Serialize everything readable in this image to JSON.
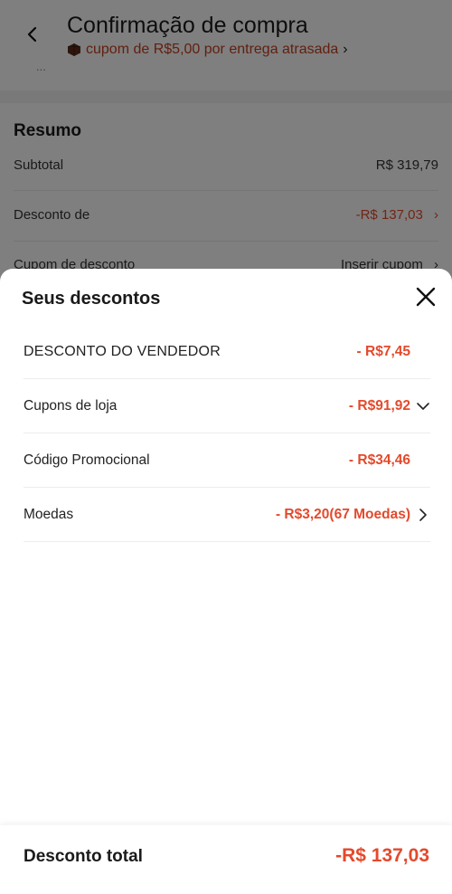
{
  "header": {
    "title": "Confirmação de compra",
    "subtitle": "cupom de R$5,00 por entrega atrasada",
    "subtitle_chevron": "›",
    "cut_text": "..."
  },
  "summary": {
    "title": "Resumo",
    "rows": [
      {
        "label": "Subtotal",
        "value": "R$ 319,79"
      },
      {
        "label": "Desconto de",
        "value": "-R$ 137,03",
        "chevron": "›"
      },
      {
        "label": "Cupom de desconto",
        "value": "Inserir cupom",
        "chevron": "›"
      }
    ]
  },
  "sheet": {
    "title": "Seus descontos",
    "rows": [
      {
        "label": "DESCONTO DO VENDEDOR",
        "value": "- R$7,45"
      },
      {
        "label": "Cupons de loja",
        "value": "- R$91,92"
      },
      {
        "label": "Código Promocional",
        "value": "- R$34,46"
      },
      {
        "label": "Moedas",
        "value": "- R$3,20(67 Moedas)"
      }
    ]
  },
  "footer": {
    "label": "Desconto total",
    "value": "-R$ 137,03"
  },
  "colors": {
    "accent": "#e4492c",
    "header_sub": "#c43f1f"
  },
  "icons": {
    "back": "back-arrow-icon",
    "box": "package-icon",
    "close": "close-icon",
    "chevron_down": "chevron-down-icon",
    "chevron_right": "chevron-right-icon"
  }
}
